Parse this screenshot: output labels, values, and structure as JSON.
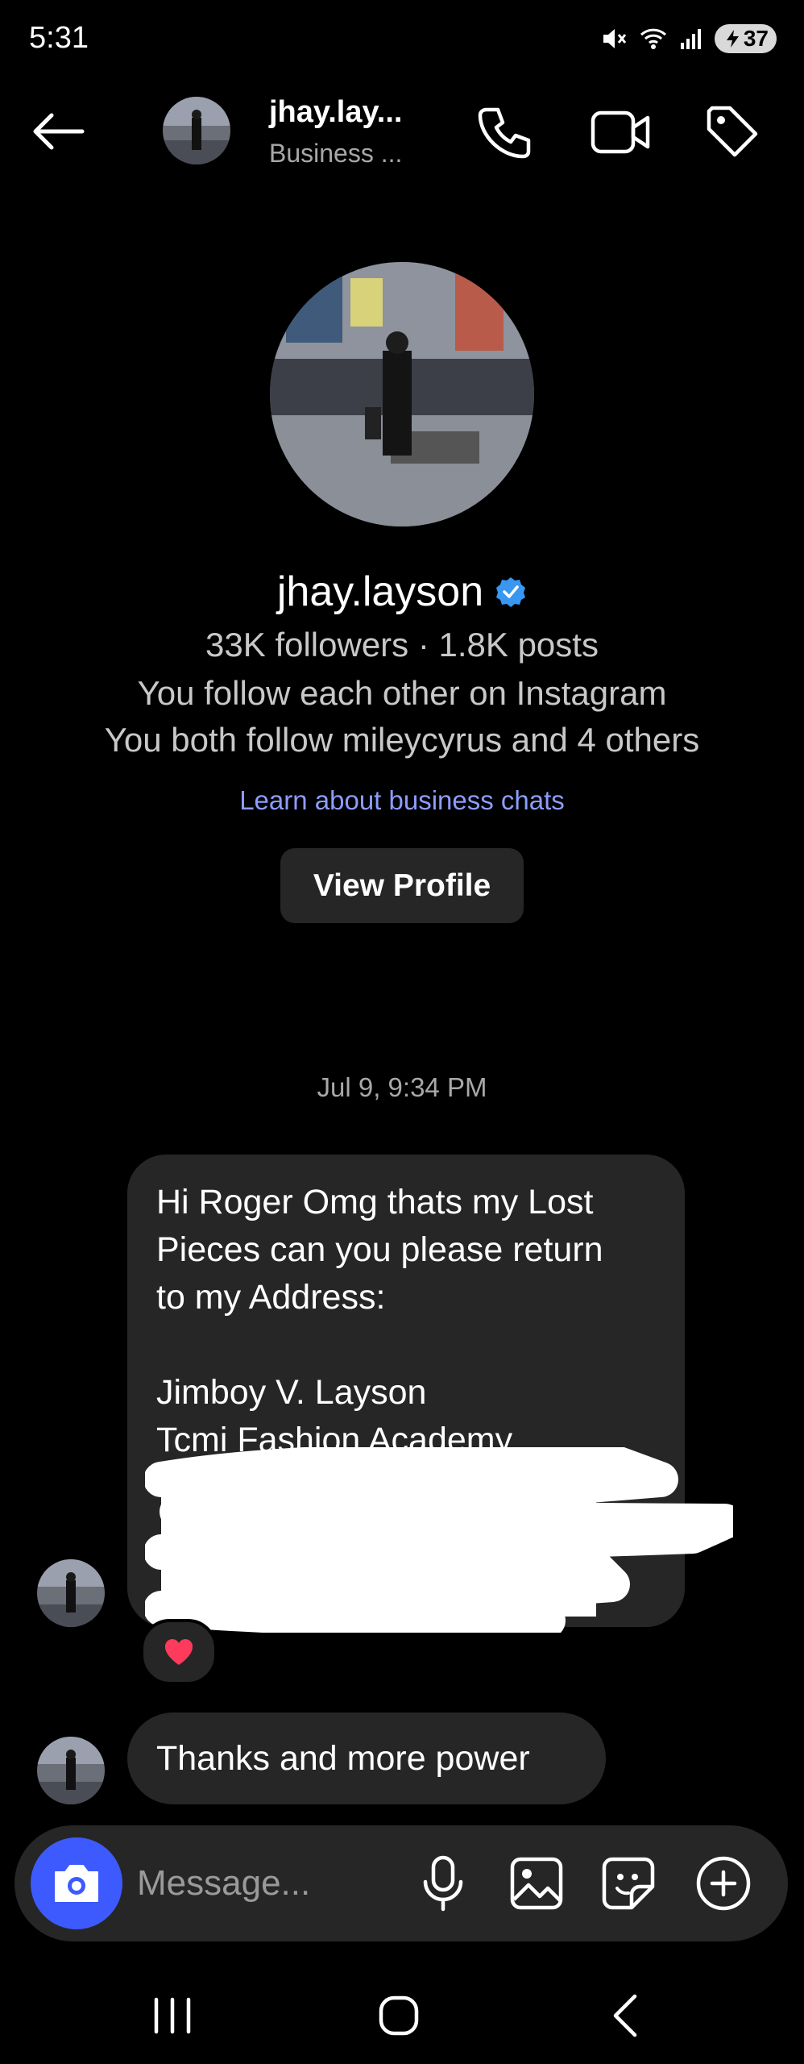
{
  "status_bar": {
    "time": "5:31",
    "battery": "37"
  },
  "header": {
    "name": "jhay.lay...",
    "subtitle": "Business ..."
  },
  "profile": {
    "name": "jhay.layson",
    "stats": "33K followers · 1.8K posts",
    "mutual_follow": "You follow each other on Instagram",
    "mutual_friends": "You both follow mileycyrus and 4 others",
    "learn_link": "Learn about business chats",
    "view_profile_label": "View Profile"
  },
  "conversation": {
    "timestamp": "Jul 9, 9:34 PM",
    "messages": [
      {
        "lines": [
          "Hi Roger Omg thats my Lost",
          "Pieces can you please return",
          "to my Address:",
          "",
          "Jimboy V. Layson",
          "Tcmi Fashion Academy"
        ],
        "reaction": "❤️"
      },
      {
        "text": "Thanks and more power"
      }
    ]
  },
  "composer": {
    "placeholder": "Message..."
  },
  "colors": {
    "accent": "#3d5afe",
    "link": "#8c9dff",
    "bubble": "#262626",
    "verified": "#3897f0"
  }
}
